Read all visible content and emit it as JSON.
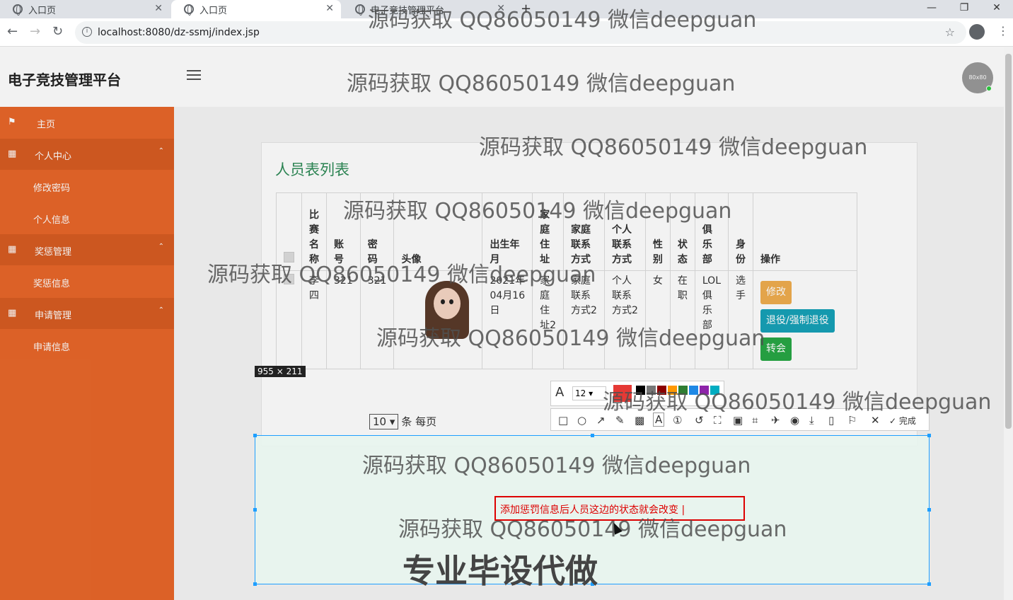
{
  "browser": {
    "tabs": [
      {
        "title": "入口页"
      },
      {
        "title": "入口页"
      },
      {
        "title": "电子竞技管理平台"
      }
    ],
    "url": "localhost:8080/dz-ssmj/index.jsp"
  },
  "header": {
    "brand": "电子竞技管理平台",
    "avatar": "80x80"
  },
  "sidebar": {
    "items": [
      {
        "label": "主页",
        "type": "item",
        "icon": "flag-icon"
      },
      {
        "label": "个人中心",
        "type": "group",
        "icon": "grid-icon"
      },
      {
        "label": "修改密码",
        "type": "sub"
      },
      {
        "label": "个人信息",
        "type": "sub"
      },
      {
        "label": "奖惩管理",
        "type": "group",
        "icon": "grid-icon"
      },
      {
        "label": "奖惩信息",
        "type": "sub"
      },
      {
        "label": "申请管理",
        "type": "group",
        "icon": "grid-icon"
      },
      {
        "label": "申请信息",
        "type": "sub"
      }
    ]
  },
  "card": {
    "title": "人员表列表"
  },
  "table": {
    "headers": [
      "比\n赛\n名\n称",
      "账\n号",
      "密\n码",
      "头像",
      "出生年\n月",
      "家\n庭\n住\n址",
      "家庭\n联系\n方式",
      "个人\n联系\n方式",
      "性\n别",
      "状\n态",
      "俱\n乐\n部",
      "身\n份",
      "操作"
    ],
    "rows": [
      [
        "李\n四",
        "321",
        "321",
        "",
        "2021年\n04月16\n日",
        "家\n庭\n住\n址2",
        "家庭\n联系\n方式2",
        "个人\n联系\n方式2",
        "女",
        "在\n职",
        "LOL\n俱\n乐\n部",
        "选\n手"
      ]
    ],
    "actions": [
      "修改",
      "退役/强制退役",
      "转会"
    ]
  },
  "pager": {
    "value": "10",
    "label": "条 每页"
  },
  "screenshot_tool": {
    "dimensions": "955 × 211",
    "font_size": "12",
    "done": "完成",
    "annotation": "添加惩罚信息后人员这边的状态就会改变",
    "big_text": "专业毕设代做"
  },
  "watermark": "源码获取 QQ86050149 微信deepguan",
  "colors": {
    "sidebar": "#e8672a",
    "accent": "#2e8b57",
    "selection": "#1e9fff",
    "annotation": "#dd0000"
  }
}
